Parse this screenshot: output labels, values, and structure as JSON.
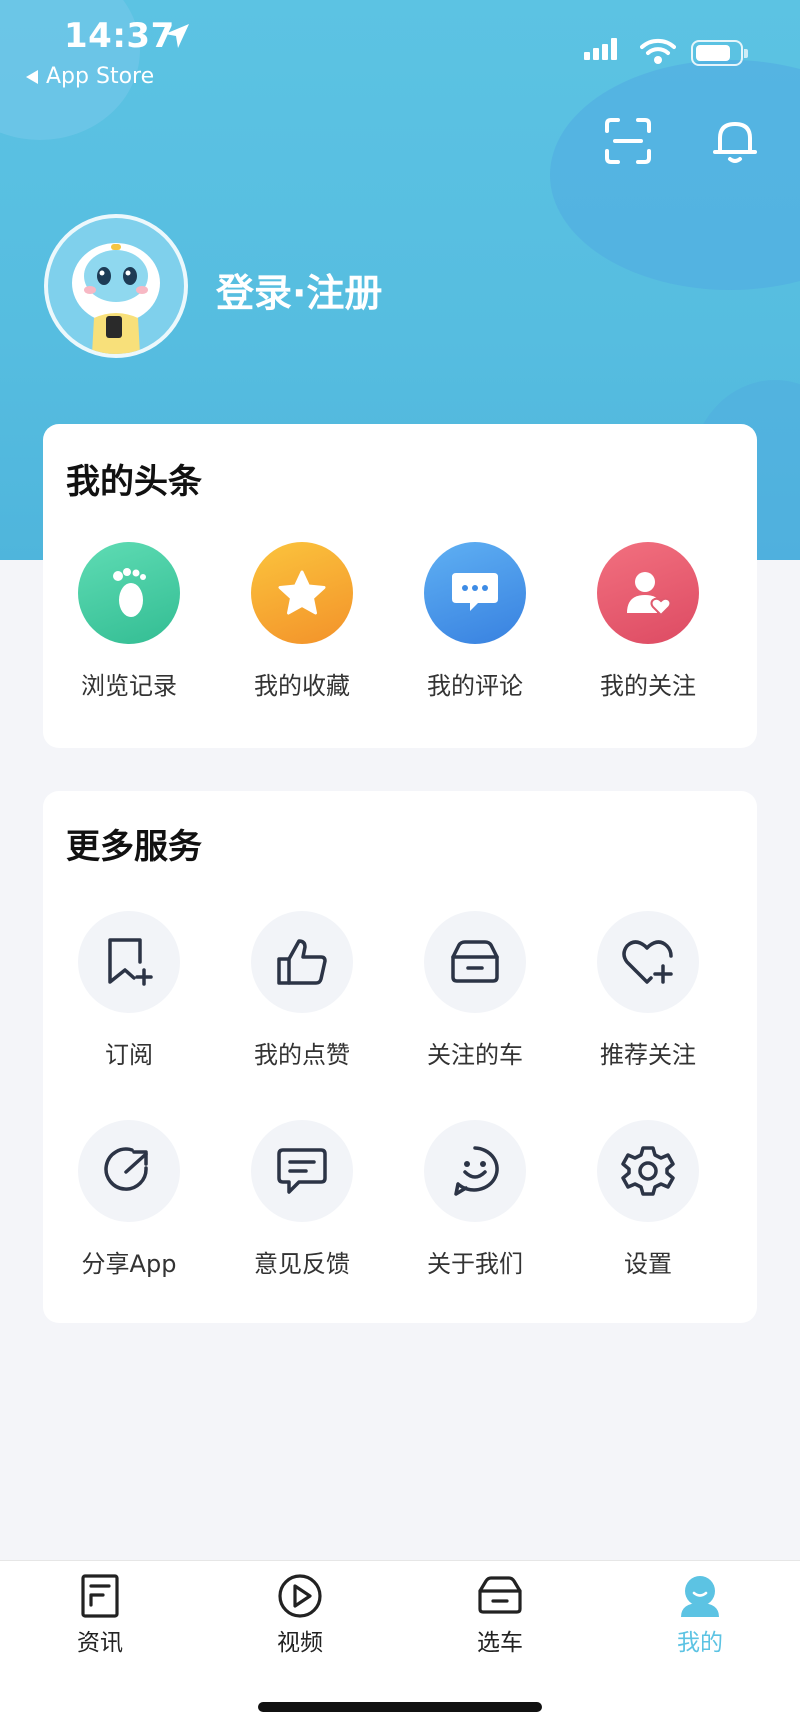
{
  "status_bar": {
    "time": "14:37",
    "back_label": "App Store"
  },
  "header": {
    "login_label": "登录·注册"
  },
  "my_headlines": {
    "title": "我的头条",
    "items": [
      {
        "label": "浏览记录",
        "icon": "footprint-icon",
        "color": "#3ec9a0"
      },
      {
        "label": "我的收藏",
        "icon": "star-icon",
        "color": "#f5a623"
      },
      {
        "label": "我的评论",
        "icon": "comment-icon",
        "color": "#3d93e8"
      },
      {
        "label": "我的关注",
        "icon": "user-heart-icon",
        "color": "#e85a6f"
      }
    ]
  },
  "more_services": {
    "title": "更多服务",
    "items": [
      {
        "label": "订阅",
        "icon": "bookmark-plus-icon"
      },
      {
        "label": "我的点赞",
        "icon": "thumbs-up-icon"
      },
      {
        "label": "关注的车",
        "icon": "car-icon"
      },
      {
        "label": "推荐关注",
        "icon": "heart-plus-icon"
      },
      {
        "label": "分享App",
        "icon": "share-icon"
      },
      {
        "label": "意见反馈",
        "icon": "feedback-icon"
      },
      {
        "label": "关于我们",
        "icon": "smile-icon"
      },
      {
        "label": "设置",
        "icon": "gear-icon"
      }
    ]
  },
  "tabbar": {
    "tabs": [
      {
        "label": "资讯",
        "icon": "news-icon"
      },
      {
        "label": "视频",
        "icon": "play-icon"
      },
      {
        "label": "选车",
        "icon": "car-icon"
      },
      {
        "label": "我的",
        "icon": "profile-icon",
        "active": true
      }
    ],
    "accent_color": "#5cc3e3"
  }
}
